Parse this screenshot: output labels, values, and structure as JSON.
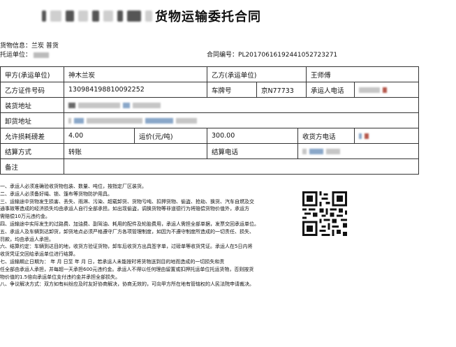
{
  "document": {
    "title": "货物运输委托合同",
    "cargo_info_label": "货物信息：",
    "cargo_info_value": "兰炭 普货",
    "shipper_label": "托运单位：",
    "contract_no_label": "合同编号：",
    "contract_no_value": "PL2017061619244105272327​1"
  },
  "table": {
    "party_a_label": "甲方(承运单位)",
    "party_a_value": "神木兰炭",
    "party_b_label": "乙方(承运单位)",
    "party_b_value": "王师傅",
    "b_id_label": "乙方证件号码",
    "b_id_value": "130984198810092252",
    "plate_label": "车牌号",
    "plate_value": "京N77733",
    "carrier_phone_label": "承运人电话",
    "loading_addr_label": "装货地址",
    "unloading_addr_label": "卸货地址",
    "loss_label": "允许损耗磅差",
    "loss_value": "4.00",
    "price_label": "运价(元/吨)",
    "price_value": "300.00",
    "receiver_phone_label": "收货方电话",
    "settle_method_label": "结算方式",
    "settle_method_value": "转账",
    "settle_phone_label": "结算电话",
    "remark_label": "备注"
  },
  "terms": [
    "一、承运人必须准确验收货物包装、数量、吨位，按指定厂区装货。",
    "二、承运人必须备好绳、锁、篷布等货物防护用具。",
    "三、运输途中货物发生损害、丢失、雨淋、污染、超载卸货、货物亏吨、扣押货物、偷盗、抢劫、换货、汽车自燃及交",
    "通事故等造成的经济损失均由承运人自行全部承担。如出现偷盗，调换货物等非道德行为将赔偿货物价值外，承运方",
    "需赔偿10万元违约金。",
    "四、运输途中实际发生的过路费、加油费、副驾油、耗用的配件及轮胎费用，承运人需担全部单据，发票交回承运单位。",
    "五、承运人及车辆到达卸货，卸货地点必须严格遵守厂方各项管理制度，如因为不遵守制度所造成的一切责任、损失、",
    "罚款，均由承运人承担。",
    "六、结算约定：车辆到达目的地，收货方验证货物，卸车后收货方出具签字单，过磅单等收货凭证。承运人在5日内将",
    "收货凭证交回给承运单位进行结算。",
    "七、运输期止日期为：    年    月    日至    年    月    日，若承运人未能按时将货物送到目的地而造成的一切损失和责",
    "任全部由承运人承担，并每超一天承担600元违约金。承运人不得以任何理由留置或扣押托运单位托运货物，否则按货",
    "物价值的1.5倍向承运单位支付违约金并承担全部损失。",
    "八、争议解决方式：双方如有纠纷应及时友好协商解决，协商无效的，可向甲方所在地有管辖权的人民法院申请裁决。"
  ],
  "icons": {
    "qr": "qr-code-icon"
  }
}
